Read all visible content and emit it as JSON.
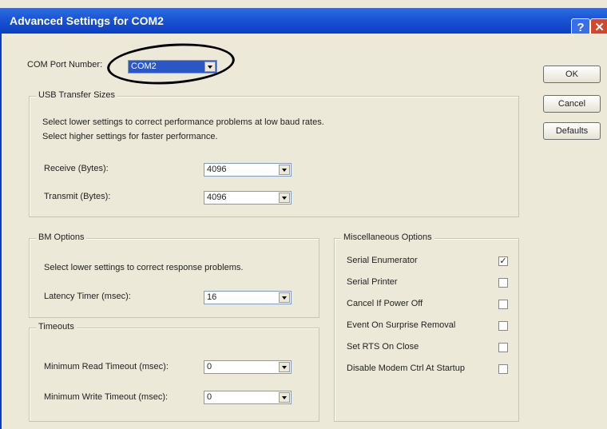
{
  "window": {
    "title": "Advanced Settings for COM2"
  },
  "com_port": {
    "label": "COM Port Number:",
    "value": "COM2"
  },
  "usb": {
    "title": "USB Transfer Sizes",
    "desc1": "Select lower settings to correct performance problems at low baud rates.",
    "desc2": "Select higher settings for faster performance.",
    "receive_label": "Receive (Bytes):",
    "receive_value": "4096",
    "transmit_label": "Transmit (Bytes):",
    "transmit_value": "4096"
  },
  "bm": {
    "title": "BM Options",
    "desc": "Select lower settings to correct response problems.",
    "latency_label": "Latency Timer (msec):",
    "latency_value": "16"
  },
  "timeouts": {
    "title": "Timeouts",
    "read_label": "Minimum Read Timeout (msec):",
    "read_value": "0",
    "write_label": "Minimum Write Timeout (msec):",
    "write_value": "0"
  },
  "misc": {
    "title": "Miscellaneous Options",
    "items": [
      {
        "label": "Serial Enumerator",
        "checked": "✓"
      },
      {
        "label": "Serial Printer",
        "checked": ""
      },
      {
        "label": "Cancel If Power Off",
        "checked": ""
      },
      {
        "label": "Event On Surprise Removal",
        "checked": ""
      },
      {
        "label": "Set RTS On Close",
        "checked": ""
      },
      {
        "label": "Disable Modem Ctrl At Startup",
        "checked": ""
      }
    ]
  },
  "buttons": {
    "ok": "OK",
    "cancel": "Cancel",
    "defaults": "Defaults"
  }
}
